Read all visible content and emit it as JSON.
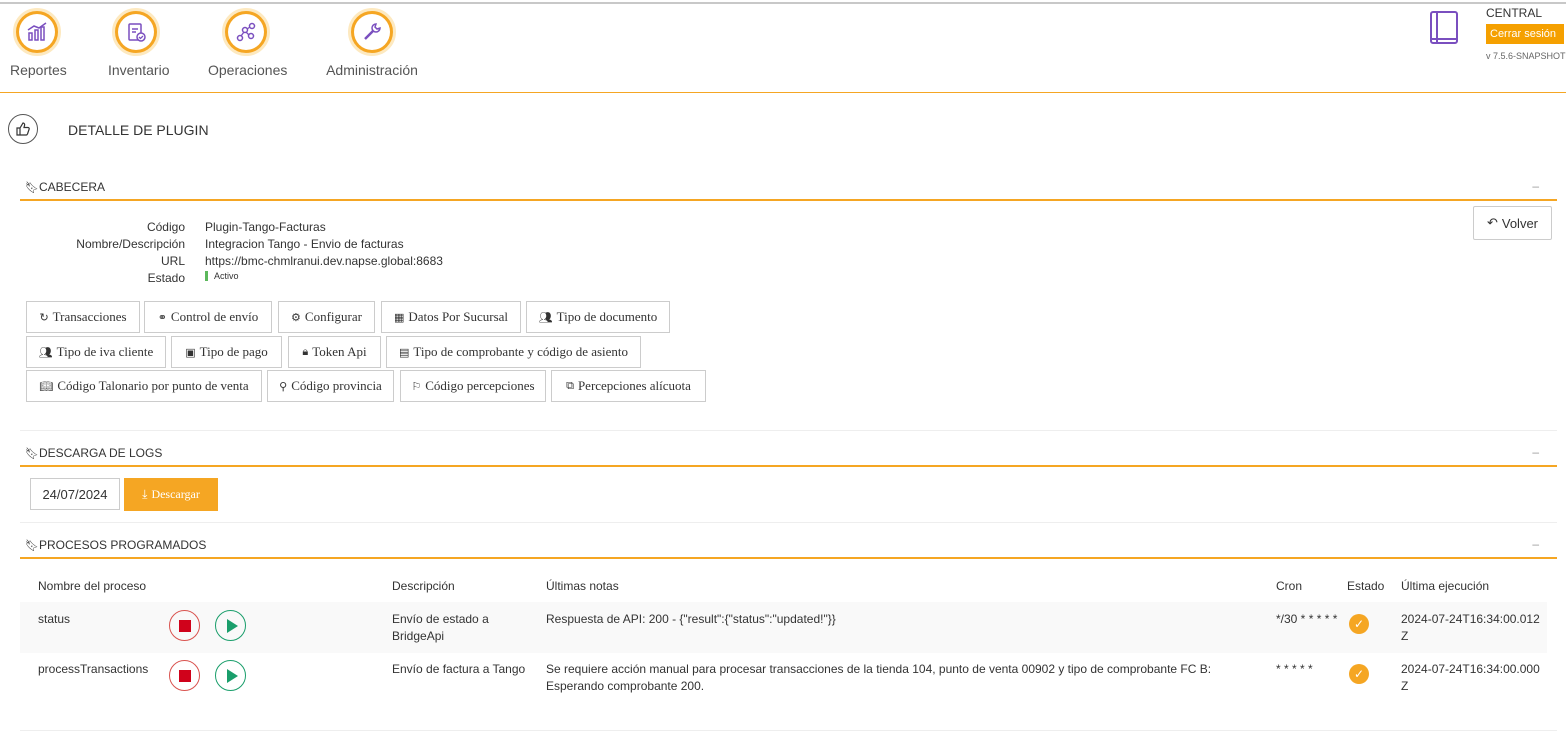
{
  "nav": {
    "items": [
      {
        "label": "Reportes",
        "icon": "reports-chart-icon"
      },
      {
        "label": "Inventario",
        "icon": "clipboard-check-icon"
      },
      {
        "label": "Operaciones",
        "icon": "nodes-graph-icon"
      },
      {
        "label": "Administración",
        "icon": "wrench-icon"
      }
    ]
  },
  "user": {
    "store": "CENTRAL",
    "logout_label": "Cerrar sesión",
    "version": "v 7.5.6-SNAPSHOT"
  },
  "page": {
    "title": "DETALLE DE PLUGIN"
  },
  "cabecera": {
    "section_label": "CABECERA",
    "fields": [
      {
        "key": "Código",
        "value": "Plugin-Tango-Facturas"
      },
      {
        "key": "Nombre/Descripción",
        "value": "Integracion Tango - Envio de facturas"
      },
      {
        "key": "URL",
        "value": "https://bmc-chmlranui.dev.napse.global:8683"
      },
      {
        "key": "Estado",
        "value": "Activo"
      }
    ],
    "back_label": "Volver",
    "buttons": [
      {
        "label": "Transacciones",
        "icon": "refresh-icon"
      },
      {
        "label": "Control de envío",
        "icon": "link-icon"
      },
      {
        "label": "Configurar",
        "icon": "gear-icon"
      },
      {
        "label": "Datos Por Sucursal",
        "icon": "building-icon"
      },
      {
        "label": "Tipo de documento",
        "icon": "users-icon"
      },
      {
        "label": "Tipo de iva cliente",
        "icon": "users-icon"
      },
      {
        "label": "Tipo de pago",
        "icon": "money-icon"
      },
      {
        "label": "Token Api",
        "icon": "lock-icon"
      },
      {
        "label": "Tipo de comprobante y código de asiento",
        "icon": "file-icon"
      },
      {
        "label": "Código Talonario por punto de venta",
        "icon": "book-open-icon"
      },
      {
        "label": "Código provincia",
        "icon": "map-marker-icon"
      },
      {
        "label": "Código percepciones",
        "icon": "flag-icon"
      },
      {
        "label": "Percepciones alícuota",
        "icon": "copy-icon"
      }
    ]
  },
  "logs": {
    "section_label": "DESCARGA DE LOGS",
    "date": "24/07/2024",
    "download_label": "Descargar"
  },
  "procesos": {
    "section_label": "PROCESOS PROGRAMADOS",
    "columns": [
      "Nombre del proceso",
      "Descripción",
      "Últimas notas",
      "Cron",
      "Estado",
      "Última ejecución"
    ],
    "rows": [
      {
        "name": "status",
        "description": "Envío de estado a BridgeApi",
        "notes": "Respuesta de API: 200 - {\"result\":{\"status\":\"updated!\"}}",
        "cron": "*/30 * * * * *",
        "estado": "ok",
        "last_run": "2024-07-24T16:34:00.012Z"
      },
      {
        "name": "processTransactions",
        "description": "Envío de factura a Tango",
        "notes": "Se requiere acción manual para procesar transacciones de la tienda 104, punto de venta 00902 y tipo de comprobante FC B: Esperando comprobante 200.",
        "cron": "* * * * *",
        "estado": "ok",
        "last_run": "2024-07-24T16:34:00.000Z"
      }
    ]
  },
  "colors": {
    "accent": "#f5a623",
    "stop": "#d0021b",
    "play": "#1a9e6b",
    "active": "#5cb85c"
  }
}
